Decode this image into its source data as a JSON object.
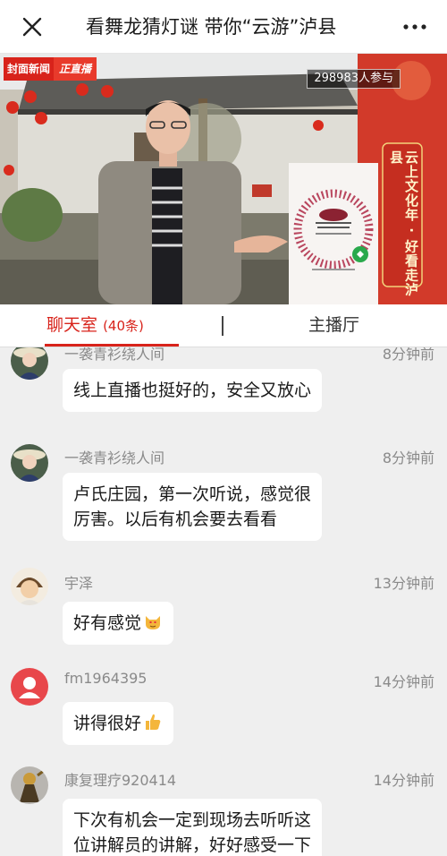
{
  "nav": {
    "title": "看舞龙猜灯谜 带你“云游”泸县",
    "close_icon": "close-icon",
    "more_icon": "more-icon"
  },
  "video": {
    "brand": "封面新闻",
    "status": "正直播",
    "viewers": "298983人参与",
    "banner_text": "云上文化年 · 好看走泸县"
  },
  "tabs": {
    "chat_label": "聊天室",
    "chat_count": "(40条)",
    "host_label": "主播厅",
    "active": "chat"
  },
  "messages": [
    {
      "name": "一袭青衫绕人间",
      "time": "8分钟前",
      "text": "线上直播也挺好的，安全又放心",
      "avatar": "woman-hat-avatar"
    },
    {
      "name": "一袭青衫绕人间",
      "time": "8分钟前",
      "lines": [
        "卢氏庄园，第一次听说，感觉很",
        "厉害。以后有机会要去看看"
      ],
      "avatar": "woman-hat-avatar"
    },
    {
      "name": "宇泽",
      "time": "13分钟前",
      "text": "好有感觉",
      "emoji": "heart-eyes-cat-emoji",
      "avatar": "cartoon-boy-avatar"
    },
    {
      "name": "fm1964395",
      "time": "14分钟前",
      "text": "讲得很好",
      "emoji": "thumbs-up-emoji",
      "avatar": "default-user-avatar"
    },
    {
      "name": "康复理疗920414",
      "time": "14分钟前",
      "lines": [
        "下次有机会一定到现场去听听这",
        "位讲解员的讲解，好好感受一下"
      ],
      "avatar": "warrior-avatar"
    }
  ],
  "colors": {
    "accent": "#d8231b",
    "chat_background": "#efefef",
    "bubble": "#ffffff",
    "meta_text": "#8a8a8a"
  }
}
